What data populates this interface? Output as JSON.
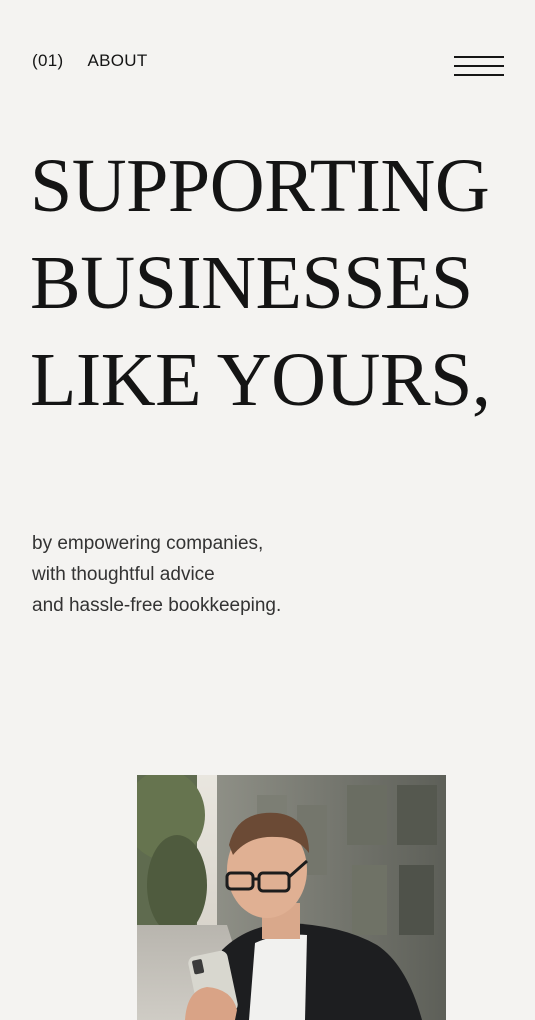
{
  "header": {
    "section_number": "(01)",
    "section_title": "ABOUT",
    "menu_icon": "hamburger-menu-icon"
  },
  "hero": {
    "headline_lines": [
      "SUPPORTING",
      "BUSINESSES",
      "LIKE YOURS,"
    ],
    "subtext_lines": [
      "by empowering companies,",
      "with thoughtful advice",
      "and hassle-free bookkeeping."
    ]
  },
  "colors": {
    "background": "#f4f3f1",
    "text": "#151515"
  }
}
